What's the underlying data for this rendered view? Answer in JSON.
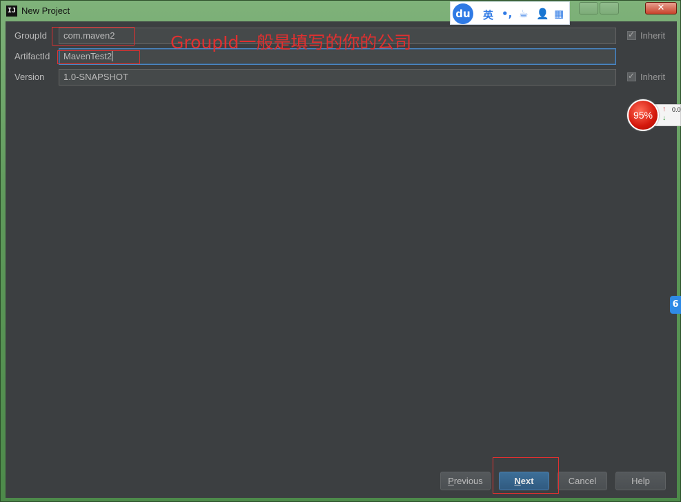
{
  "window": {
    "title": "New Project",
    "app_icon": "IJ",
    "close_glyph": "✕"
  },
  "form": {
    "group_id": {
      "label": "GroupId",
      "value": "com.maven2",
      "inherit_label": "Inherit"
    },
    "artifact_id": {
      "label": "ArtifactId",
      "value": "MavenTest2"
    },
    "version": {
      "label": "Version",
      "value": "1.0-SNAPSHOT",
      "inherit_label": "Inherit"
    }
  },
  "annotation": {
    "text": "GroupId一般是填写的你的公司",
    "color": "#e03030"
  },
  "buttons": {
    "previous": {
      "mnemonic": "P",
      "rest": "revious"
    },
    "next": {
      "mnemonic": "N",
      "rest": "ext"
    },
    "cancel": "Cancel",
    "help": "Help"
  },
  "ime_toolbar": {
    "logo": "du",
    "lang": "英",
    "punct": "•,",
    "cup": "☕",
    "user": "👤",
    "grid": "▦"
  },
  "speed_widget": {
    "percent": "95%",
    "up": "↑",
    "down": "↓",
    "value": "0.0"
  },
  "side_tab": {
    "glyph": "6"
  },
  "colors": {
    "accent": "#4a88c7",
    "background": "#3c3f41",
    "field": "#45494a"
  }
}
